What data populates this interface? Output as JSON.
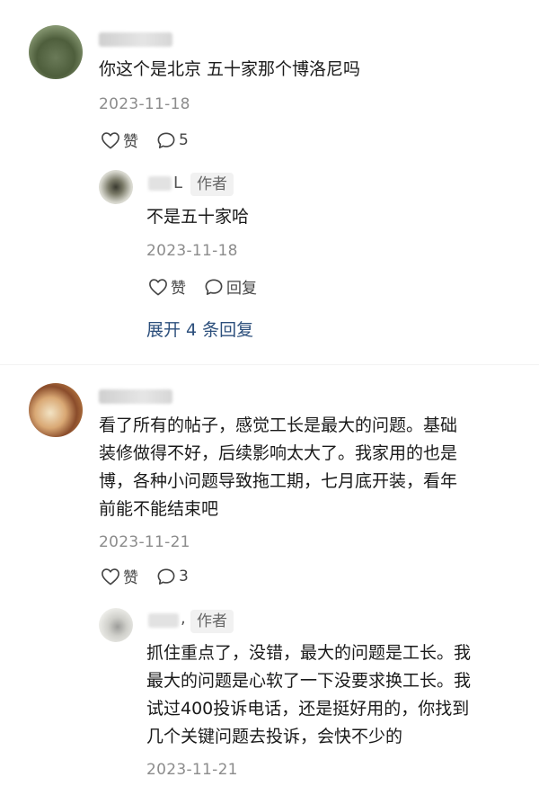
{
  "comments": [
    {
      "text": "你这个是北京 五十家那个博洛尼吗",
      "date": "2023-11-18",
      "like_label": "赞",
      "reply_count": "5",
      "reply": {
        "name_tail": "L",
        "author_tag": "作者",
        "text": "不是五十家哈",
        "date": "2023-11-18",
        "like_label": "赞",
        "reply_label": "回复"
      },
      "expand_label": "展开 4 条回复"
    },
    {
      "text_lines": [
        "看了所有的帖子，感觉工长是最大的问题。基础",
        "装修做得不好，后续影响太大了。我家用的也是",
        "博，各种小问题导致拖工期，七月底开装，看年",
        "前能不能结束吧"
      ],
      "date": "2023-11-21",
      "like_label": "赞",
      "reply_count": "3",
      "reply": {
        "name_tail": ",",
        "author_tag": "作者",
        "text_lines": [
          "抓住重点了，没错，最大的问题是工长。我",
          "最大的问题是心软了一下没要求换工长。我",
          "试过400投诉电话，还是挺好用的，你找到",
          "几个关键问题去投诉，会快不少的"
        ],
        "date": "2023-11-21"
      }
    }
  ],
  "icons": {
    "like": "heart-outline-icon",
    "comment": "chat-bubble-icon"
  },
  "colors": {
    "link": "#2c4f7c",
    "date": "#8c8c8c",
    "tag_bg": "#f1f1f1"
  }
}
